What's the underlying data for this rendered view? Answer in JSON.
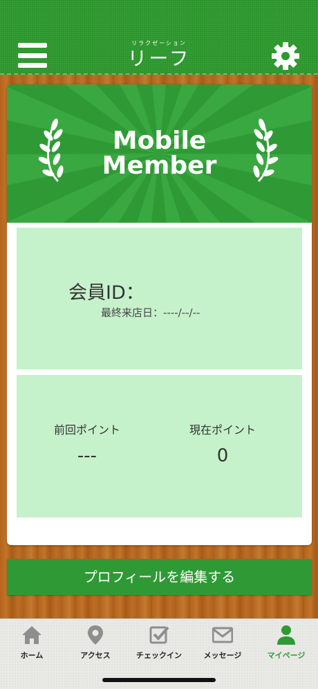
{
  "header": {
    "menu_icon": "hamburger-icon",
    "logo_subtitle": "リラクゼーション",
    "logo_title": "リーフ",
    "settings_icon": "gear-icon"
  },
  "card": {
    "banner_title_line1": "Mobile",
    "banner_title_line2": "Member",
    "member_id_label": "会員ID：",
    "last_visit": "最終来店日：----/--/--",
    "previous_points_label": "前回ポイント",
    "previous_points_value": "---",
    "current_points_label": "現在ポイント",
    "current_points_value": "0"
  },
  "edit_profile_label": "プロフィールを編集する",
  "tabbar": {
    "tabs": [
      {
        "label": "ホーム",
        "icon": "home-icon"
      },
      {
        "label": "アクセス",
        "icon": "location-pin-icon"
      },
      {
        "label": "チェックイン",
        "icon": "checkbox-icon"
      },
      {
        "label": "メッセージ",
        "icon": "mail-icon"
      },
      {
        "label": "マイページ",
        "icon": "person-icon"
      }
    ],
    "active_index": 4
  },
  "colors": {
    "brand_green": "#2f9a35",
    "panel_green": "#c6f2cb",
    "tab_inactive": "#8e8e8e"
  }
}
